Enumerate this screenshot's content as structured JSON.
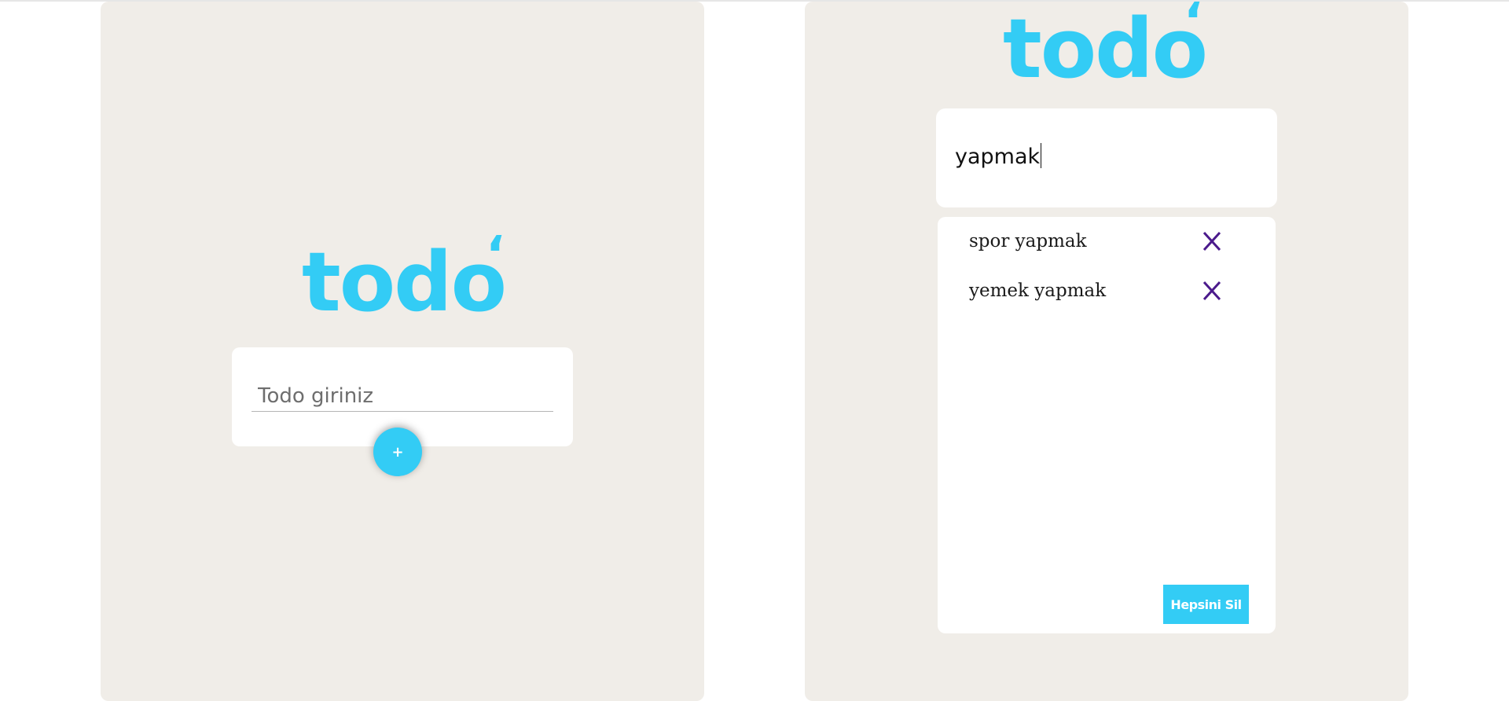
{
  "left_panel": {
    "logo_text": "todo",
    "logo_mark": "‘",
    "input_placeholder": "Todo giriniz",
    "add_button_label": "+"
  },
  "right_panel": {
    "logo_text": "todo",
    "logo_mark": "‘",
    "input_value": "yapmak",
    "todos": [
      {
        "text": "spor yapmak",
        "delete_icon": "close-x-icon"
      },
      {
        "text": "yemek yapmak",
        "delete_icon": "close-x-icon"
      }
    ],
    "clear_all_label": "Hepsini Sil"
  },
  "colors": {
    "accent": "#33ccf5",
    "panel_bg": "#f0ede8",
    "card_bg": "#ffffff",
    "delete_icon": "#4b1a8c"
  }
}
